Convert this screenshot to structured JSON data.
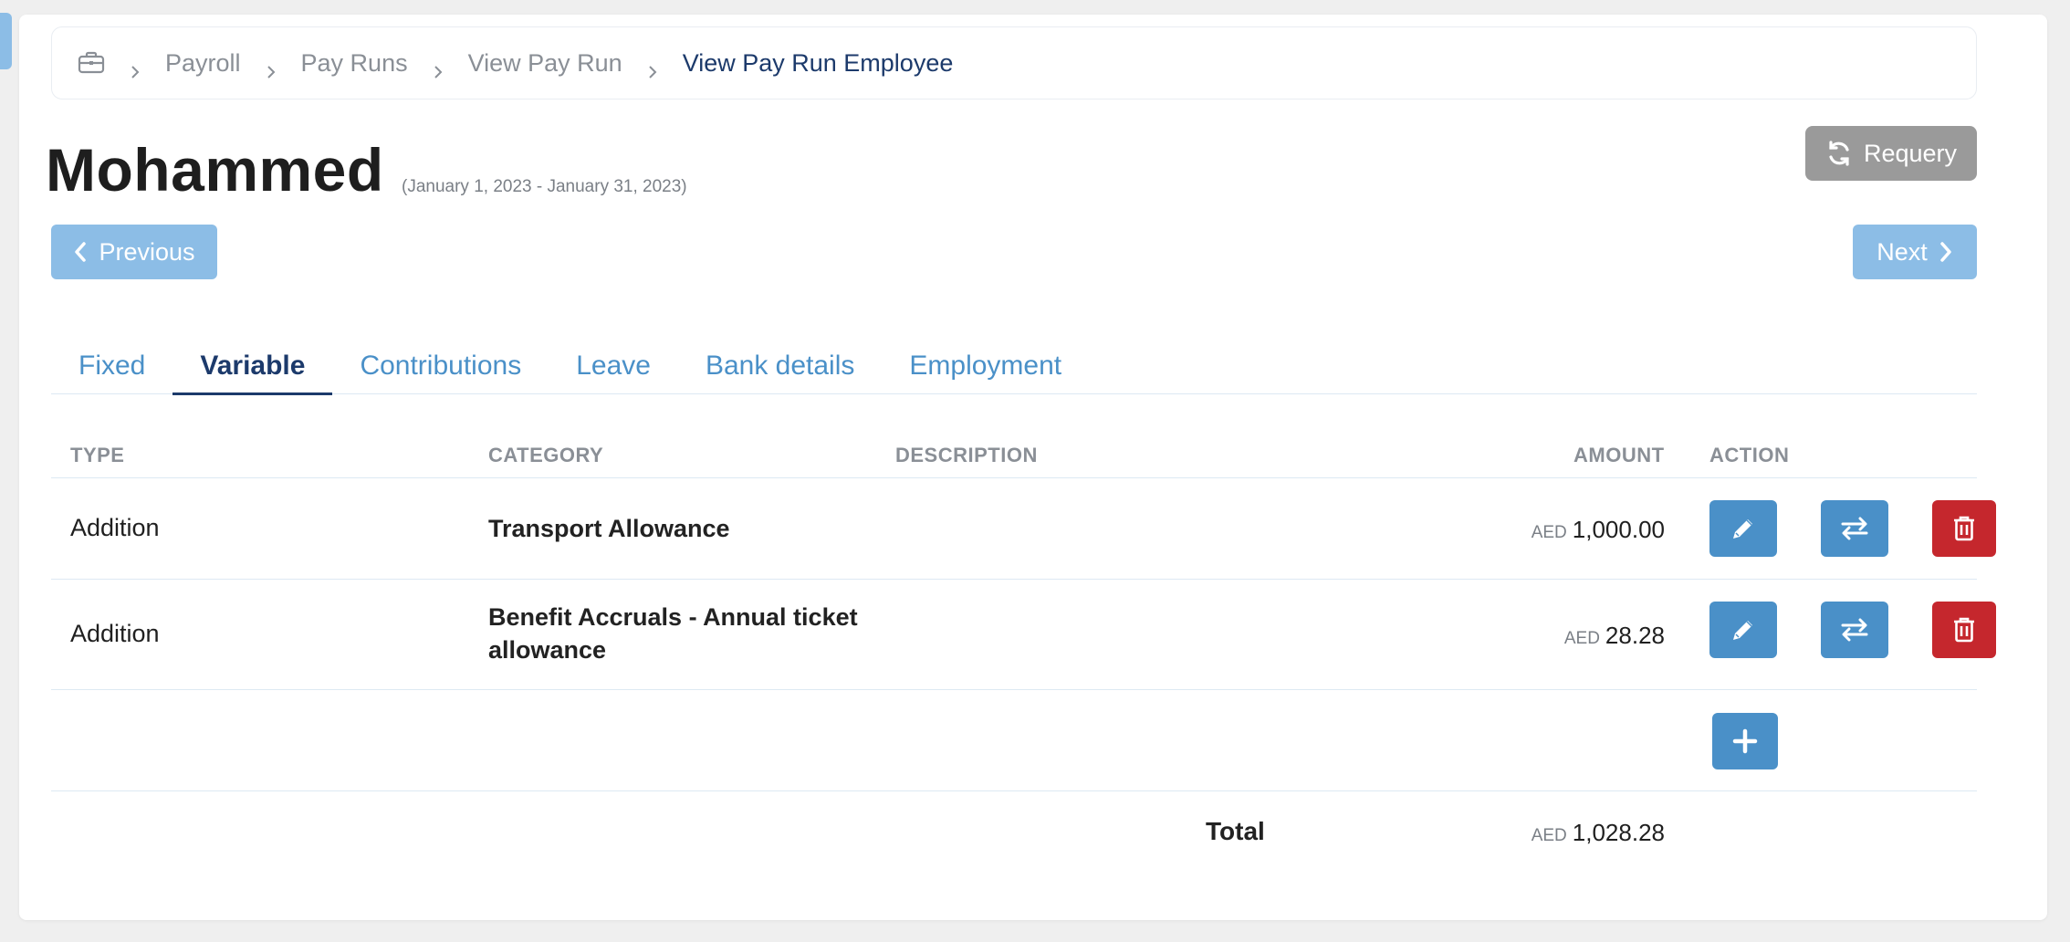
{
  "breadcrumb": {
    "items": [
      "Payroll",
      "Pay Runs",
      "View Pay Run"
    ],
    "current": "View Pay Run Employee"
  },
  "employee": {
    "name": "Mohammed",
    "period": "(January 1, 2023 - January 31, 2023)"
  },
  "buttons": {
    "requery": "Requery",
    "previous": "Previous",
    "next": "Next"
  },
  "tabs": [
    {
      "label": "Fixed",
      "active": false
    },
    {
      "label": "Variable",
      "active": true
    },
    {
      "label": "Contributions",
      "active": false
    },
    {
      "label": "Leave",
      "active": false
    },
    {
      "label": "Bank details",
      "active": false
    },
    {
      "label": "Employment",
      "active": false
    }
  ],
  "table": {
    "headers": {
      "type": "TYPE",
      "category": "CATEGORY",
      "description": "DESCRIPTION",
      "amount": "AMOUNT",
      "action": "ACTION"
    },
    "rows": [
      {
        "type": "Addition",
        "category": "Transport Allowance",
        "description": "",
        "currency": "AED",
        "amount": "1,000.00"
      },
      {
        "type": "Addition",
        "category": "Benefit Accruals - Annual ticket allowance",
        "description": "",
        "currency": "AED",
        "amount": "28.28"
      }
    ],
    "total": {
      "label": "Total",
      "currency": "AED",
      "amount": "1,028.28"
    }
  },
  "colors": {
    "primary": "#4a90c8",
    "light_primary": "#8cbde6",
    "danger": "#c5272d",
    "dark_navy": "#1c3a6b",
    "neutral_button": "#9a9a9a"
  }
}
